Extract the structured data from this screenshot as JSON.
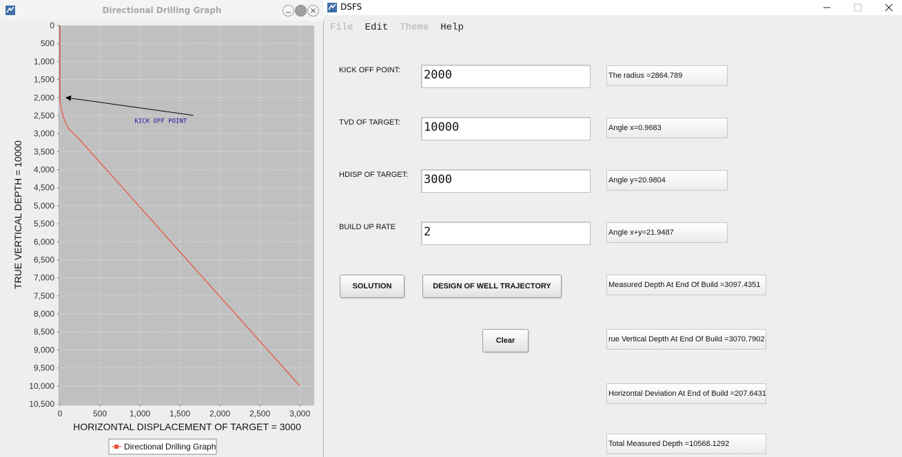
{
  "graph_window": {
    "title": "Directional Drilling Graph",
    "icons": {
      "app": "java-app-icon",
      "minimize": "minimize-circle-icon",
      "maximize": "maximize-circle-icon",
      "close": "close-circle-icon"
    }
  },
  "chart_data": {
    "type": "line",
    "xlabel": "HORIZONTAL DISPLACEMENT OF TARGET = 3000",
    "ylabel": "TRUE VERTICAL DEPTH = 10000",
    "xlim": [
      0,
      3180
    ],
    "ylim": [
      0,
      10500
    ],
    "y_inverted": true,
    "x_ticks": [
      0,
      500,
      1000,
      1500,
      2000,
      2500,
      3000
    ],
    "x_tick_labels": [
      "0",
      "500",
      "1,000",
      "1,500",
      "2,000",
      "2,500",
      "3,000"
    ],
    "y_ticks": [
      0,
      500,
      1000,
      1500,
      2000,
      2500,
      3000,
      3500,
      4000,
      4500,
      5000,
      5500,
      6000,
      6500,
      7000,
      7500,
      8000,
      8500,
      9000,
      9500,
      10000,
      10500
    ],
    "y_tick_labels": [
      "0",
      "500",
      "1,000",
      "1,500",
      "2,000",
      "2,500",
      "3,000",
      "3,500",
      "4,000",
      "4,500",
      "5,000",
      "5,500",
      "6,000",
      "6,500",
      "7,000",
      "7,500",
      "8,000",
      "8,500",
      "9,000",
      "9,500",
      "10,000",
      "10,500"
    ],
    "grid": true,
    "background_color": "#c0c0c0",
    "series": [
      {
        "name": "Directional Drilling Graph",
        "color": "#e8513d",
        "x": [
          0,
          0,
          5,
          20,
          45,
          80,
          120,
          207.64,
          3000
        ],
        "y": [
          0,
          2000,
          2150,
          2350,
          2550,
          2750,
          2900,
          3070.79,
          10000
        ]
      }
    ],
    "annotation": {
      "text": "KICK OFF POINT",
      "point": [
        0,
        2000
      ],
      "label_at": [
        1150,
        2550
      ]
    },
    "legend": "bottom-center"
  },
  "dsfs_window": {
    "title": "DSFS",
    "icons": {
      "app": "java-app-icon",
      "minimize": "minimize-icon",
      "maximize": "maximize-icon",
      "close": "close-icon"
    },
    "menu": [
      {
        "label": "File",
        "enabled": false
      },
      {
        "label": "Edit",
        "enabled": true
      },
      {
        "label": "Theme",
        "enabled": false
      },
      {
        "label": "Help",
        "enabled": true
      }
    ],
    "form": {
      "kick_off_label": "KICK OFF POINT:",
      "kick_off_value": "2000",
      "tvd_label": "TVD OF TARGET:",
      "tvd_value": "10000",
      "hdisp_label": "HDISP OF TARGET:",
      "hdisp_value": "3000",
      "bur_label": "BUILD UP RATE",
      "bur_value": "2"
    },
    "buttons": {
      "solution": "SOLUTION",
      "design": "DESIGN OF WELL TRAJECTORY",
      "clear": "Clear"
    },
    "results": {
      "radius": "The radius =2864.789",
      "angle_x": "Angle x=0.9683",
      "angle_y": "Angle y=20.9804",
      "angle_xy": "Angle x+y=21.9487",
      "md_eob": "Measured Depth At End Of Build =3097.4351",
      "tvd_eob": "rue Vertical Depth At End Of Build =3070.7902",
      "hd_eob": "Horizontal Deviation At End of Build =207.6431",
      "tmd": "Total Measured Depth =10568.1292"
    }
  }
}
